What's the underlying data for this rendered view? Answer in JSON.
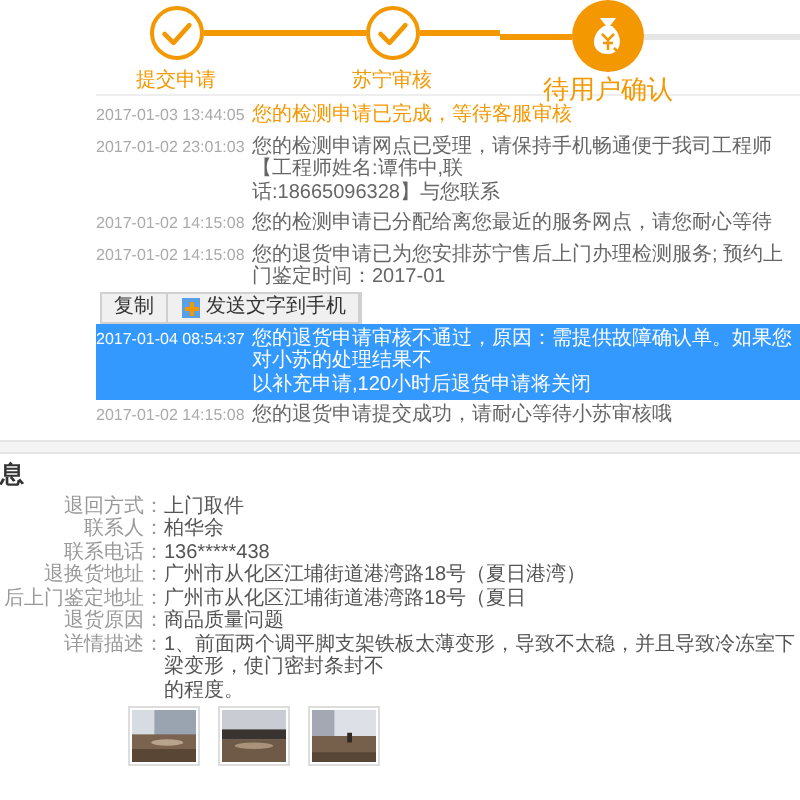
{
  "steps": [
    {
      "label": "提交申请",
      "current": false
    },
    {
      "label": "苏宁审核",
      "current": false
    },
    {
      "label": "待用户确认",
      "current": true
    }
  ],
  "log": [
    {
      "time": "2017-01-03 13:44:05",
      "lines": [
        "您的检测申请已完成，等待客服审核"
      ],
      "emphasis": true,
      "highlighted": false
    },
    {
      "time": "2017-01-02 23:01:03",
      "lines": [
        "您的检测申请网点已受理，请保持手机畅通便于我司工程师【工程师姓名:谭伟中,联",
        "话:18665096328】与您联系"
      ],
      "emphasis": false,
      "highlighted": false
    },
    {
      "time": "2017-01-02 14:15:08",
      "lines": [
        "您的检测申请已分配给离您最近的服务网点，请您耐心等待"
      ],
      "emphasis": false,
      "highlighted": false
    },
    {
      "time": "2017-01-02 14:15:08",
      "lines": [
        "您的退货申请已为您安排苏宁售后上门办理检测服务; 预约上门鉴定时间：2017-01"
      ],
      "emphasis": false,
      "highlighted": false
    },
    {
      "time": "2017-01-04 08:54:37",
      "lines": [
        "您的退货申请审核不通过，原因：需提供故障确认单。如果您对小苏的处理结果不",
        "以补充申请,120小时后退货申请将关闭"
      ],
      "emphasis": false,
      "highlighted": true
    },
    {
      "time": "2017-01-02 14:15:08",
      "lines": [
        "您的退货申请提交成功，请耐心等待小苏审核哦"
      ],
      "emphasis": false,
      "highlighted": false
    }
  ],
  "context_menu": {
    "items": [
      {
        "label": "复制",
        "kind": "plain"
      },
      {
        "label": "发送文字到手机",
        "kind": "phone"
      }
    ]
  },
  "details": {
    "title": "息",
    "fields": [
      {
        "label": "退回方式：",
        "lines": [
          "上门取件"
        ]
      },
      {
        "label": "联系人：",
        "lines": [
          "柏华余"
        ]
      },
      {
        "label": "联系电话：",
        "lines": [
          "136*****438"
        ]
      },
      {
        "label": "退换货地址：",
        "lines": [
          "广州市从化区江埔街道港湾路18号（夏日港湾）"
        ]
      },
      {
        "label": "后上门鉴定地址：",
        "lines": [
          "广州市从化区江埔街道港湾路18号（夏日"
        ]
      },
      {
        "label": "退货原因：",
        "lines": [
          "商品质量问题"
        ]
      },
      {
        "label": "详情描述：",
        "lines": [
          "1、前面两个调平脚支架铁板太薄变形，导致不太稳，并且导致冷冻室下梁变形，使门密封条封不",
          "的程度。"
        ]
      }
    ]
  }
}
